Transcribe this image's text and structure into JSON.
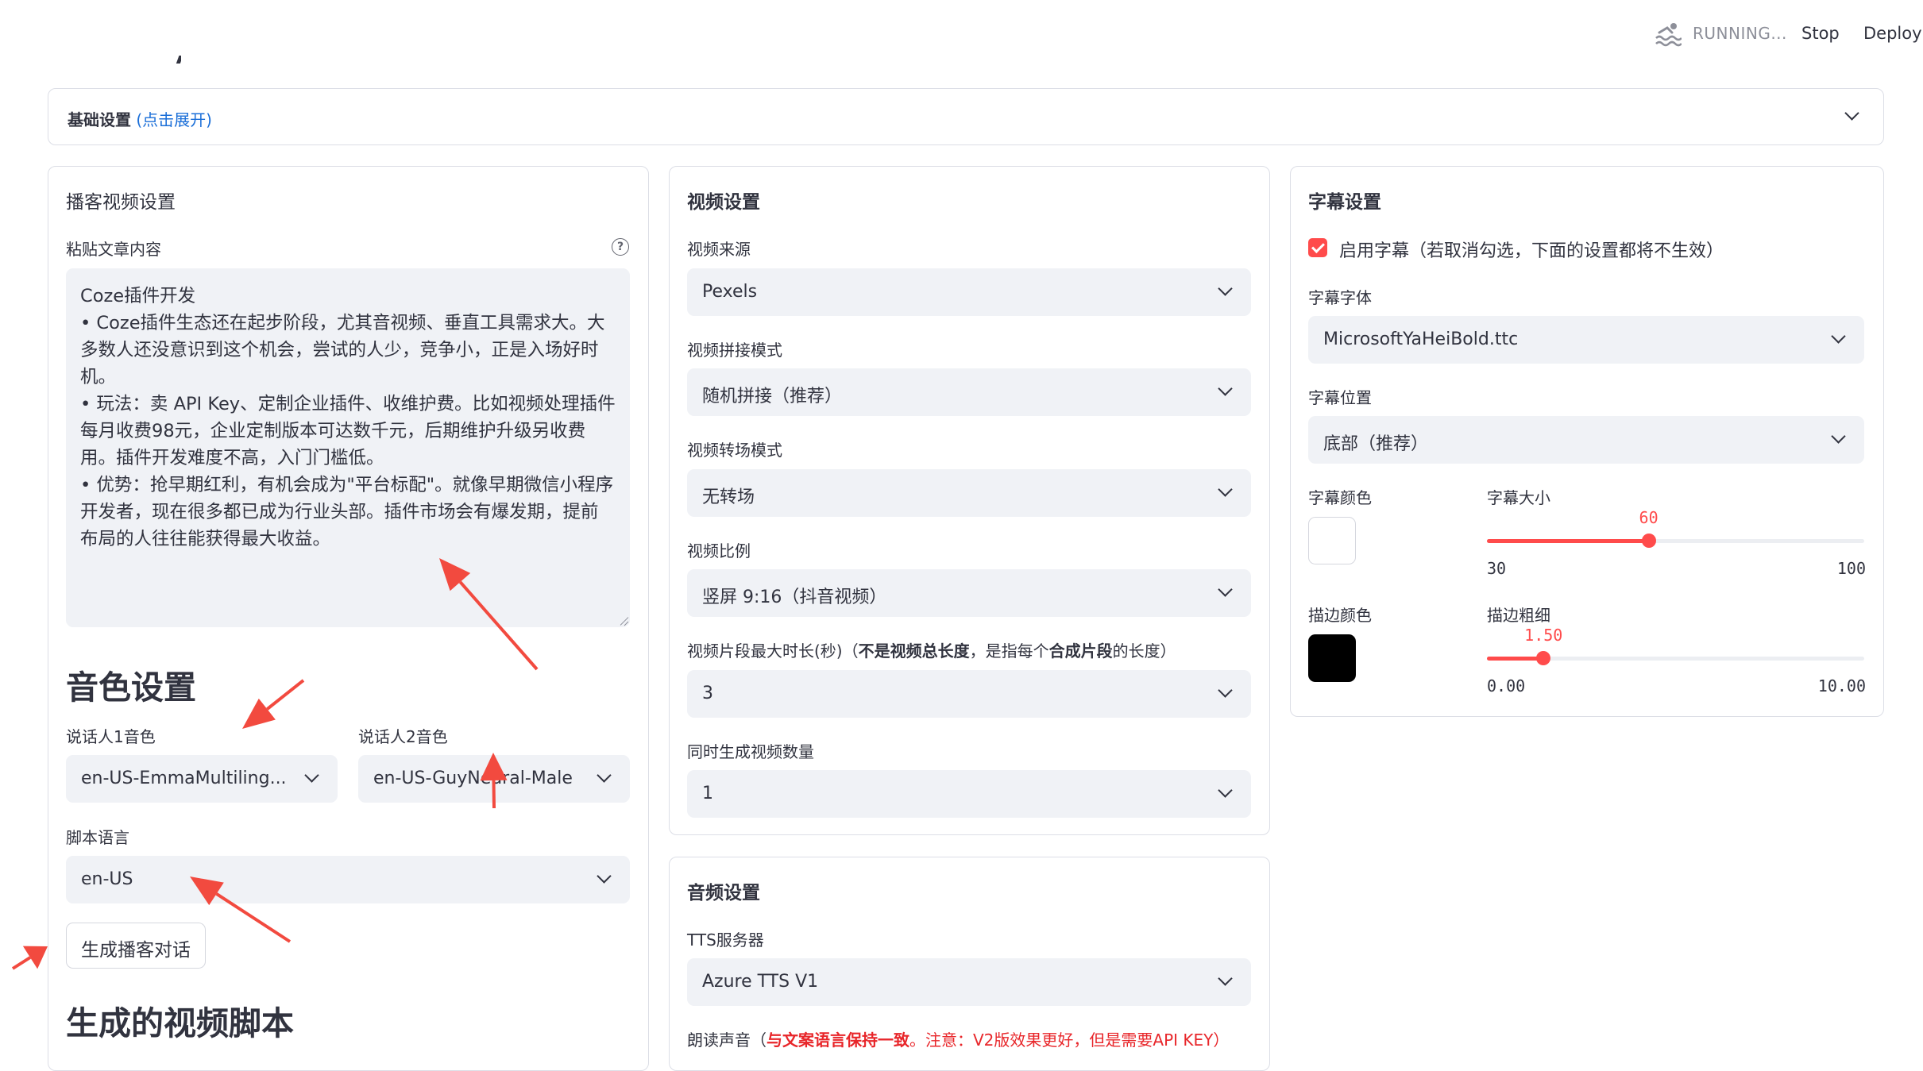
{
  "header": {
    "status_text": "RUNNING...",
    "stop_label": "Stop",
    "deploy_label": "Deploy"
  },
  "expander": {
    "title": "基础设置",
    "hint": "(点击展开)"
  },
  "podcast": {
    "title": "播客视频设置",
    "paste_label": "粘贴文章内容",
    "help_icon": "?",
    "article_text": "Coze插件开发\n• Coze插件生态还在起步阶段，尤其音视频、垂直工具需求大。大多数人还没意识到这个机会，尝试的人少，竞争小，正是入场好时机。\n• 玩法：卖 API Key、定制企业插件、收维护费。比如视频处理插件每月收费98元，企业定制版本可达数千元，后期维护升级另收费用。插件开发难度不高，入门门槛低。\n• 优势：抢早期红利，有机会成为\"平台标配\"。就像早期微信小程序开发者，现在很多都已成为行业头部。插件市场会有爆发期，提前布局的人往往能获得最大收益。",
    "voice_heading": "音色设置",
    "speaker1_label": "说话人1音色",
    "speaker1_value": "en-US-EmmaMultiling...",
    "speaker2_label": "说话人2音色",
    "speaker2_value": "en-US-GuyNeural-Male",
    "script_lang_label": "脚本语言",
    "script_lang_value": "en-US",
    "generate_button": "生成播客对话",
    "script_heading": "生成的视频脚本"
  },
  "video": {
    "title": "视频设置",
    "source_label": "视频来源",
    "source_value": "Pexels",
    "concat_label": "视频拼接模式",
    "concat_value": "随机拼接（推荐）",
    "transition_label": "视频转场模式",
    "transition_value": "无转场",
    "ratio_label": "视频比例",
    "ratio_value": "竖屏 9:16（抖音视频）",
    "clip_label_a": "视频片段最大时长(秒)（",
    "clip_label_b": "不是视频总长度",
    "clip_label_c": "，是指每个",
    "clip_label_d": "合成片段",
    "clip_label_e": "的长度）",
    "clip_value": "3",
    "count_label": "同时生成视频数量",
    "count_value": "1"
  },
  "audio": {
    "title": "音频设置",
    "tts_label": "TTS服务器",
    "tts_value": "Azure TTS V1",
    "voice_label_a": "朗读声音（",
    "voice_label_b": "与文案语言保持一致",
    "voice_label_c": "。注意：V2版效果更好，但是需要API KEY）"
  },
  "subtitle": {
    "title": "字幕设置",
    "enable_label": "启用字幕（若取消勾选，下面的设置都将不生效）",
    "enabled": true,
    "font_label": "字幕字体",
    "font_value": "MicrosoftYaHeiBold.ttc",
    "position_label": "字幕位置",
    "position_value": "底部（推荐）",
    "color_label": "字幕颜色",
    "color_value": "#ffffff",
    "size_label": "字幕大小",
    "size_value": "60",
    "size_min": "30",
    "size_max": "100",
    "size_fraction": 0.4286,
    "stroke_color_label": "描边颜色",
    "stroke_color_value": "#000000",
    "stroke_width_label": "描边粗细",
    "stroke_width_value": "1.50",
    "stroke_min": "0.00",
    "stroke_max": "10.00",
    "stroke_fraction": 0.15
  },
  "colors": {
    "accent": "#ff4b4b",
    "link": "#1a6ed8",
    "arrow": "#f24a3f"
  }
}
